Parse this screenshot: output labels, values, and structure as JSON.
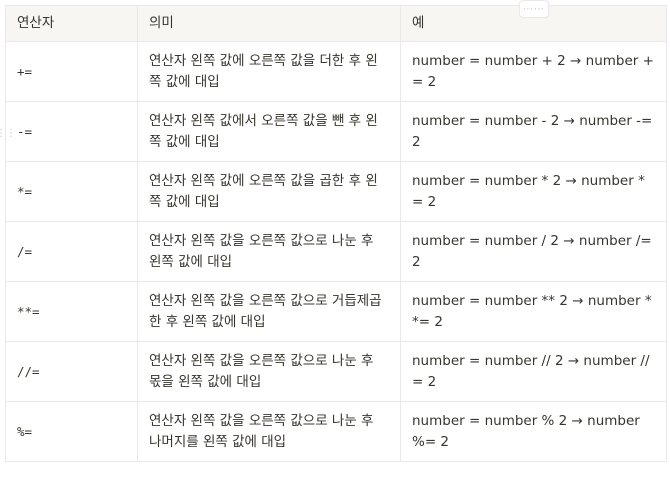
{
  "table": {
    "headers": {
      "operator": "연산자",
      "meaning": "의미",
      "example": "예"
    },
    "rows": [
      {
        "operator": "+=",
        "meaning": "연산자 왼쪽 값에 오른쪽 값을 더한 후 왼쪽 값에 대입",
        "example": "number = number + 2 → number += 2"
      },
      {
        "operator": "-=",
        "meaning": "연산자 왼쪽 값에서 오른쪽 값을 뺀 후 왼쪽 값에 대입",
        "example": "number = number - 2 → number -= 2"
      },
      {
        "operator": "*=",
        "meaning": "연산자 왼쪽 값에 오른쪽 값을 곱한 후 왼쪽 값에 대입",
        "example": "number = number * 2 → number *= 2"
      },
      {
        "operator": "/=",
        "meaning": "연산자 왼쪽 값을 오른쪽 값으로 나눈 후 왼쪽 값에 대입",
        "example": "number = number / 2 → number /= 2"
      },
      {
        "operator": "**=",
        "meaning": "연산자 왼쪽 값을 오른쪽 값으로 거듭제곱한 후 왼쪽 값에 대입",
        "example": "number = number ** 2 → number **= 2"
      },
      {
        "operator": "//=",
        "meaning": "연산자 왼쪽 값을 오른쪽 값으로 나눈 후 몫을 왼쪽 값에 대입",
        "example": "number = number // 2 → number //= 2"
      },
      {
        "operator": "%=",
        "meaning": "연산자 왼쪽 값을 오른쪽 값으로 나눈 후 나머지를 왼쪽 값에 대입",
        "example": "number = number % 2 → number %= 2"
      }
    ]
  },
  "icons": {
    "column_handle": "drag-handle-horizontal-icon",
    "row_handle": "drag-handle-vertical-icon"
  }
}
